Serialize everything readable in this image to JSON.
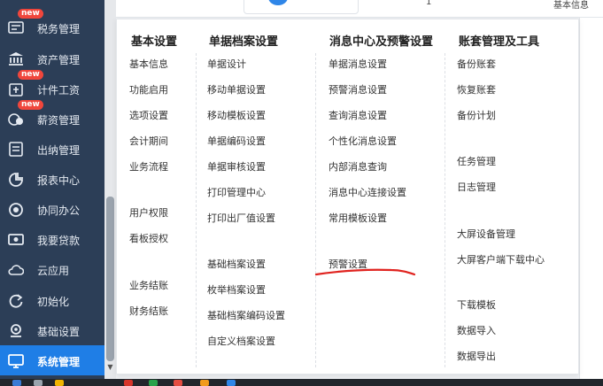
{
  "sidebar": {
    "items": [
      {
        "label": "税务管理",
        "icon": "tax-icon",
        "badge": "new",
        "active": false
      },
      {
        "label": "资产管理",
        "icon": "bank-icon",
        "badge": "",
        "active": false
      },
      {
        "label": "计件工资",
        "icon": "piece-wage-icon",
        "badge": "new",
        "active": false
      },
      {
        "label": "薪资管理",
        "icon": "salary-icon",
        "badge": "new",
        "active": false
      },
      {
        "label": "出纳管理",
        "icon": "cashier-icon",
        "badge": "",
        "active": false
      },
      {
        "label": "报表中心",
        "icon": "report-icon",
        "badge": "",
        "active": false
      },
      {
        "label": "协同办公",
        "icon": "collaboration-icon",
        "badge": "",
        "active": false
      },
      {
        "label": "我要贷款",
        "icon": "loan-icon",
        "badge": "",
        "active": false
      },
      {
        "label": "云应用",
        "icon": "cloud-icon",
        "badge": "",
        "active": false
      },
      {
        "label": "初始化",
        "icon": "init-icon",
        "badge": "",
        "active": false
      },
      {
        "label": "基础设置",
        "icon": "settings-icon",
        "badge": "",
        "active": false
      },
      {
        "label": "系统管理",
        "icon": "system-icon",
        "badge": "",
        "active": true
      }
    ]
  },
  "background": {
    "row_number": "1",
    "row_text": "基本信息"
  },
  "menu": {
    "columns": [
      {
        "title": "基本设置",
        "items": [
          "基本信息",
          "功能启用",
          "选项设置",
          "会计期间",
          "业务流程",
          "用户权限",
          "看板授权",
          "业务结账",
          "财务结账"
        ]
      },
      {
        "title": "单据档案设置",
        "items": [
          "单据设计",
          "移动单据设置",
          "移动模板设置",
          "单据编码设置",
          "单据审核设置",
          "打印管理中心",
          "打印出厂值设置",
          "基础档案设置",
          "枚举档案设置",
          "基础档案编码设置",
          "自定义档案设置"
        ]
      },
      {
        "title": "消息中心及预警设置",
        "items": [
          "单据消息设置",
          "预警消息设置",
          "查询消息设置",
          "个性化消息设置",
          "内部消息查询",
          "消息中心连接设置",
          "常用模板设置",
          "预警设置"
        ]
      },
      {
        "title": "账套管理及工具",
        "items": [
          "备份账套",
          "恢复账套",
          "备份计划",
          "任务管理",
          "日志管理",
          "大屏设备管理",
          "大屏客户端下载中心",
          "下载模板",
          "数据导入",
          "数据导出"
        ]
      }
    ]
  },
  "colors": {
    "sidebar_bg": "#2c3e57",
    "active_bg": "#1f7ee6",
    "badge_bg": "#f0463c",
    "annotation_red": "#e0231f"
  }
}
